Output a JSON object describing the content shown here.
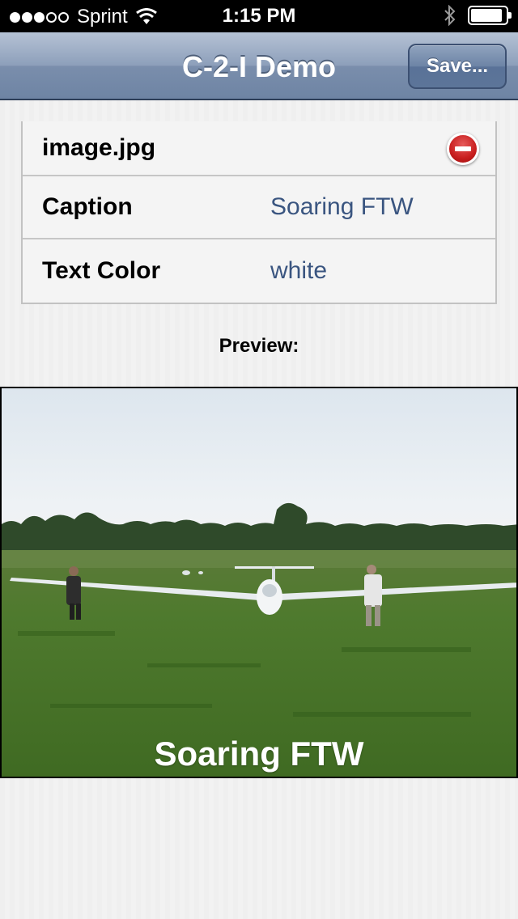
{
  "status_bar": {
    "carrier": "Sprint",
    "time": "1:15 PM",
    "signal_bars_filled": 3,
    "signal_bars_total": 5,
    "battery_level": 0.9
  },
  "nav": {
    "title": "C-2-I Demo",
    "save_label": "Save..."
  },
  "table": {
    "file_name": "image.jpg",
    "rows": [
      {
        "label": "Caption",
        "value": "Soaring FTW"
      },
      {
        "label": "Text Color",
        "value": "white"
      }
    ]
  },
  "preview": {
    "label": "Preview:",
    "caption": "Soaring FTW",
    "caption_color": "#ffffff"
  },
  "icons": [
    "wifi-icon",
    "bluetooth-icon",
    "battery-icon",
    "delete-icon"
  ],
  "colors": {
    "accent_value": "#3a5580",
    "nav_bar": "#7a8eac"
  }
}
